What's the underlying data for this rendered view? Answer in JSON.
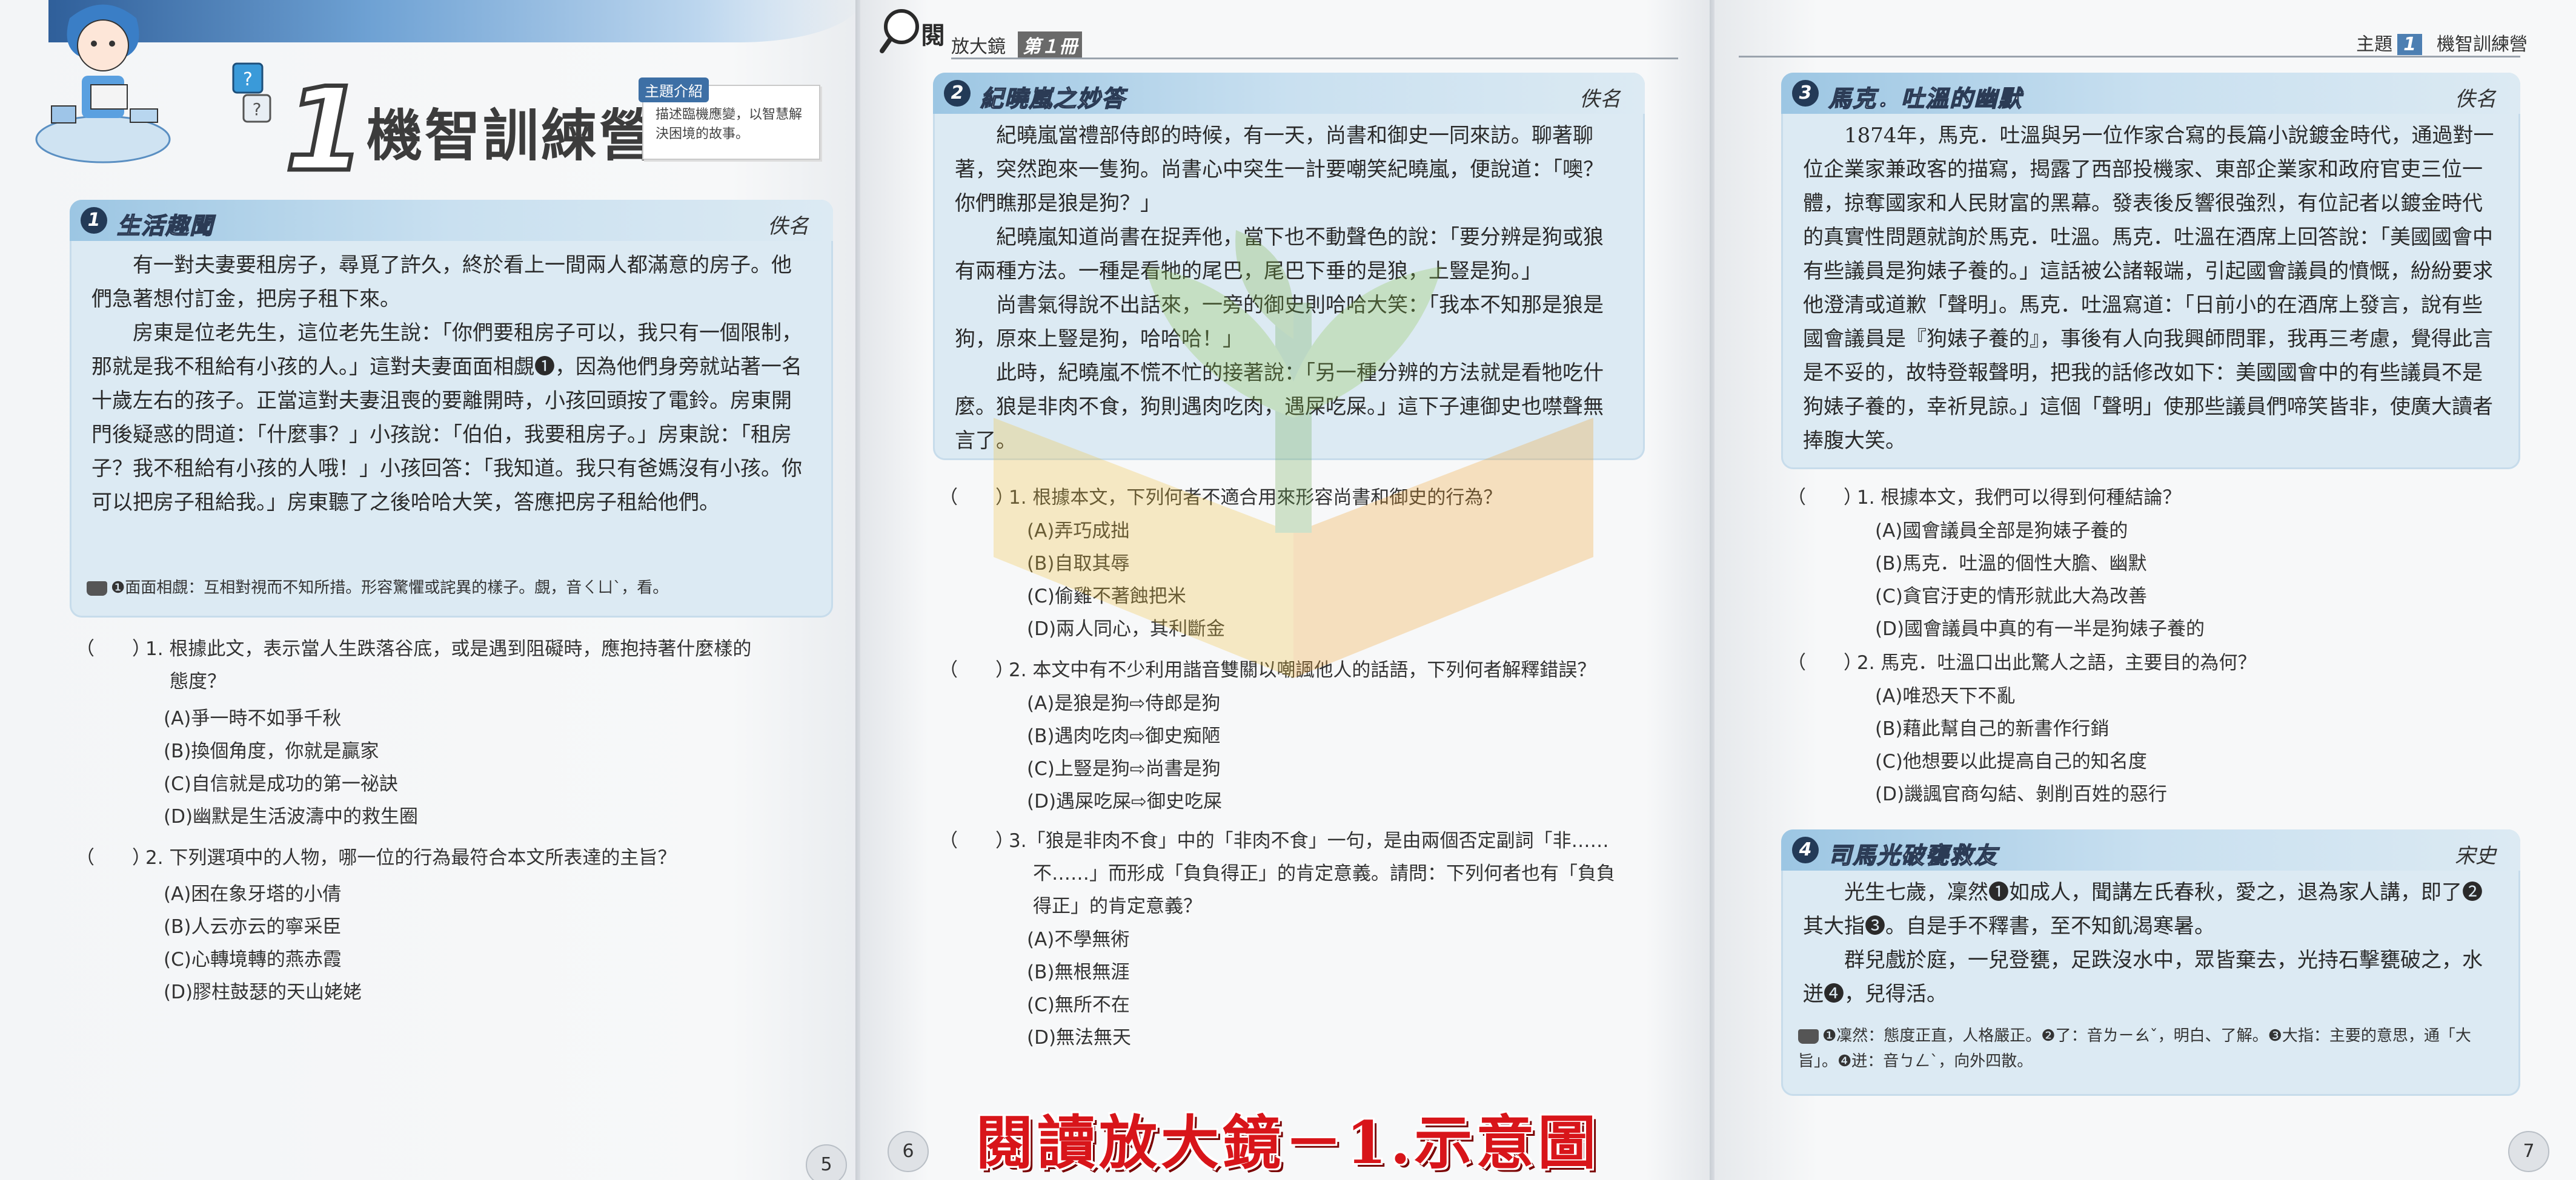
{
  "unit": {
    "number": "1",
    "title": "機智訓練營",
    "intro_tag": "主題介紹",
    "intro_text": "描述臨機應變，以智慧解決困境的故事。"
  },
  "story1": {
    "num": "1",
    "title": "生活趣聞",
    "author": "佚名",
    "paragraphs": [
      "有一對夫妻要租房子，尋覓了許久，終於看上一間兩人都滿意的房子。他們急著想付訂金，把房子租下來。",
      "房東是位老先生，這位老先生說：「你們要租房子可以，我只有一個限制，那就是我不租給有小孩的人。」這對夫妻面面相覷❶，因為他們身旁就站著一名十歲左右的孩子。正當這對夫妻沮喪的要離開時，小孩回頭按了電鈴。房東開門後疑惑的問道：「什麼事？」小孩說：「伯伯，我要租房子。」房東說：「租房子？我不租給有小孩的人哦！」小孩回答：「我知道。我只有爸媽沒有小孩。你可以把房子租給我。」房東聽了之後哈哈大笑，答應把房子租給他們。"
    ],
    "gloss": "❶面面相覷：互相對視而不知所措。形容驚懼或詫異的樣子。覷，音ㄑㄩˋ，看。"
  },
  "p1_questions": [
    {
      "paren": "（　　）",
      "text": "1. 根據此文，表示當人生跌落谷底，或是遇到阻礙時，應抱持著什麼樣的",
      "text2": "態度？",
      "options": [
        "(A)爭一時不如爭千秋",
        "(B)換個角度，你就是贏家",
        "(C)自信就是成功的第一祕訣",
        "(D)幽默是生活波濤中的救生圈"
      ]
    },
    {
      "paren": "（　　）",
      "text": "2. 下列選項中的人物，哪一位的行為最符合本文所表達的主旨？",
      "options": [
        "(A)困在象牙塔的小倩",
        "(B)人云亦云的寧采臣",
        "(C)心轉境轉的燕赤霞",
        "(D)膠柱鼓瑟的天山姥姥"
      ]
    }
  ],
  "p1_pagenum": "5",
  "p2_header": {
    "brand": "閱讀",
    "series": "放大鏡",
    "tag": "第１冊"
  },
  "story2": {
    "num": "2",
    "title": "紀曉嵐之妙答",
    "author": "佚名",
    "paragraphs": [
      "紀曉嵐當禮部侍郎的時候，有一天，尚書和御史一同來訪。聊著聊著，突然跑來一隻狗。尚書心中突生一計要嘲笑紀曉嵐，便說道：「噢？你們瞧那是狼是狗？」",
      "紀曉嵐知道尚書在捉弄他，當下也不動聲色的說：「要分辨是狗或狼有兩種方法。一種是看牠的尾巴，尾巴下垂的是狼，上豎是狗。」",
      "尚書氣得說不出話來，一旁的御史則哈哈大笑：「我本不知那是狼是狗，原來上豎是狗，哈哈哈！」",
      "此時，紀曉嵐不慌不忙的接著說：「另一種分辨的方法就是看牠吃什麼。狼是非肉不食，狗則遇肉吃肉，遇屎吃屎。」這下子連御史也噤聲無言了。"
    ]
  },
  "p2_questions": [
    {
      "paren": "（　　）",
      "text": "1. 根據本文，下列何者不適合用來形容尚書和御史的行為？",
      "options": [
        "(A)弄巧成拙",
        "(B)自取其辱",
        "(C)偷雞不著蝕把米",
        "(D)兩人同心，其利斷金"
      ]
    },
    {
      "paren": "（　　）",
      "text": "2. 本文中有不少利用諧音雙關以嘲諷他人的話語，下列何者解釋錯誤？",
      "options": [
        "(A)是狼是狗⇨侍郎是狗",
        "(B)遇肉吃肉⇨御史痴陋",
        "(C)上豎是狗⇨尚書是狗",
        "(D)遇屎吃屎⇨御史吃屎"
      ]
    },
    {
      "paren": "（　　）",
      "text": "3.「狼是非肉不食」中的「非肉不食」一句，是由兩個否定副詞「非……",
      "text2": "不……」而形成「負負得正」的肯定意義。請問：下列何者也有「負負",
      "text3": "得正」的肯定意義？",
      "options": [
        "(A)不學無術",
        "(B)無根無涯",
        "(C)無所不在",
        "(D)無法無天"
      ]
    }
  ],
  "p2_pagenum": "6",
  "p3_header": {
    "topic_label": "主題",
    "topic_num": "1",
    "topic_title": "機智訓練營"
  },
  "story3": {
    "num": "3",
    "title": "馬克．吐溫的幽默",
    "author": "佚名",
    "paragraphs": [
      "1874年，馬克．吐溫與另一位作家合寫的長篇小說鍍金時代，通過對一位企業家兼政客的描寫，揭露了西部投機家、東部企業家和政府官吏三位一體，掠奪國家和人民財富的黑幕。發表後反響很強烈，有位記者以鍍金時代的真實性問題就詢於馬克．吐溫。馬克．吐溫在酒席上回答說：「美國國會中有些議員是狗婊子養的。」這話被公諸報端，引起國會議員的憤慨，紛紛要求他澄清或道歉「聲明」。馬克．吐溫寫道：「日前小的在酒席上發言，說有些國會議員是『狗婊子養的』，事後有人向我興師問罪，我再三考慮，覺得此言是不妥的，故特登報聲明，把我的話修改如下：美國國會中的有些議員不是狗婊子養的，幸祈見諒。」這個「聲明」使那些議員們啼笑皆非，使廣大讀者捧腹大笑。"
    ]
  },
  "p3_questions": [
    {
      "paren": "（　　）",
      "text": "1. 根據本文，我們可以得到何種結論？",
      "options": [
        "(A)國會議員全部是狗婊子養的",
        "(B)馬克．吐溫的個性大膽、幽默",
        "(C)貪官汙吏的情形就此大為改善",
        "(D)國會議員中真的有一半是狗婊子養的"
      ]
    },
    {
      "paren": "（　　）",
      "text": "2. 馬克．吐溫口出此驚人之語，主要目的為何？",
      "options": [
        "(A)唯恐天下不亂",
        "(B)藉此幫自己的新書作行銷",
        "(C)他想要以此提高自己的知名度",
        "(D)譏諷官商勾結、剝削百姓的惡行"
      ]
    }
  ],
  "story4": {
    "num": "4",
    "title": "司馬光破甕救友",
    "author": "宋史",
    "paragraphs": [
      "光生七歲，凜然❶如成人，聞講左氏春秋，愛之，退為家人講，即了❷其大指❸。自是手不釋書，至不知飢渴寒暑。",
      "群兒戲於庭，一兒登甕，足跌沒水中，眾皆棄去，光持石擊甕破之，水迸❹，兒得活。"
    ],
    "gloss": "❶凜然：態度正直，人格嚴正。❷了：音ㄌㄧㄠˇ，明白、了解。❸大指：主要的意思，通「大旨」。❹迸：音ㄅㄥˋ，向外四散。"
  },
  "p3_pagenum": "7",
  "caption": "閱讀放大鏡－1.示意圖",
  "colors": {
    "accent_blue": "#2f5f9a",
    "story_bg": "#dceaf3",
    "caption_red": "#d8151a"
  }
}
